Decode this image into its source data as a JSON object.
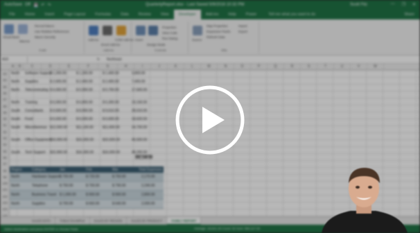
{
  "title_bar": {
    "quick_access": [
      "AutoSave",
      "Off",
      "💾",
      "↶",
      "↷"
    ],
    "document_title": "QuarterlyReport.xlsx - Last Saved 5/9/2016 10:32 PM",
    "user": "Scott Fitz",
    "window_controls": [
      "—",
      "❐",
      "✕"
    ]
  },
  "tabs": {
    "items": [
      "File",
      "Home",
      "Insert",
      "Page Layout",
      "Formulas",
      "Data",
      "Review",
      "View",
      "Developer",
      "Add-ins",
      "Help",
      "Power"
    ],
    "active": "Developer",
    "tell_me": "Tell me what you want to do",
    "share": "Share"
  },
  "ribbon": {
    "groups": [
      {
        "label": "Code",
        "buttons": [
          "Visual Basic",
          "Macros"
        ],
        "items": [
          "Record Macro",
          "Use Relative References",
          "Macro Security"
        ]
      },
      {
        "label": "Add-ins",
        "buttons": [
          "Add-ins",
          "Excel Add-ins",
          "COM Add-ins"
        ]
      },
      {
        "label": "Controls",
        "buttons": [
          "Insert",
          "Design Mode"
        ],
        "items": [
          "Properties",
          "View Code",
          "Run Dialog"
        ]
      },
      {
        "label": "XML",
        "buttons": [
          "Source"
        ],
        "items": [
          "Map Properties",
          "Expansion Packs",
          "Refresh Data",
          "Import",
          "Export"
        ]
      }
    ]
  },
  "formula_bar": {
    "name_box": "A10",
    "fx": "fx",
    "value": "Northeast"
  },
  "columns": [
    "A",
    "B",
    "C",
    "D",
    "E",
    "F",
    "G",
    "H",
    "I",
    "J",
    "K",
    "L",
    "M",
    "N",
    "O",
    "P",
    "Q",
    "R",
    "S",
    "T",
    "U",
    "V",
    "W"
  ],
  "rows": [
    "83",
    "84",
    "85",
    "86",
    "87",
    "88",
    "89",
    "90",
    "91",
    "92",
    "93",
    "94",
    "95",
    "96",
    "97",
    "98",
    "99",
    "100",
    "101",
    "102",
    "103",
    "104",
    "105"
  ],
  "data_rows": [
    {
      "region": "North",
      "category": "Software Support",
      "q1": "$ 1,200.00",
      "q2": "$ 1,200.00",
      "q3": "$ 1,400.00",
      "total": "3,800.00"
    },
    {
      "region": "North",
      "category": "Supplies",
      "q1": "$ 2,600.00",
      "q2": "$ 2,400.00",
      "q3": "$ 2,400.00",
      "total": "7,400.00"
    },
    {
      "region": "North",
      "category": "Telecommuting",
      "q1": "$ 6,000.00",
      "q2": "$ 5,900.00",
      "q3": "$ 5,700.00",
      "total": "17,600.00"
    },
    {
      "region": "North",
      "category": "Training",
      "q1": "$ 6,000.00",
      "q2": "$ 6,800.00",
      "q3": "$ 6,300.00",
      "total": "19,100.00"
    },
    {
      "region": "South",
      "category": "Consultants",
      "q1": "$ 9,500.00",
      "q2": "$ 8,900.00",
      "q3": "$ 9,610.00",
      "total": "28,010.00"
    },
    {
      "region": "South",
      "category": "Food",
      "q1": "$ 6,020.00",
      "q2": "$ 6,000.00",
      "q3": "$ 6,600.00",
      "total": "18,620.00"
    },
    {
      "region": "South",
      "category": "Miscellaneous",
      "q1": "$12,000.00",
      "q2": "$11,100.00",
      "q3": "$11,600.00",
      "total": "34,700.00"
    },
    {
      "region": "South",
      "category": "Office Equipment",
      "q1": "$16,000.00",
      "q2": "$15,000.00",
      "q3": "$15,500.00",
      "total": "46,500.00"
    },
    {
      "region": "South",
      "category": "Tech Support",
      "q1": "$15,900.00",
      "q2": "$16,300.00",
      "q3": "$16,000.00",
      "total": "48,200.00"
    }
  ],
  "grand_total": "291,140.00",
  "table2": {
    "headers": [
      "Region",
      "Category",
      "Jan",
      "Feb",
      "Mar",
      "Total Expenses"
    ],
    "rows": [
      [
        "North",
        "Hardware Support",
        "$ 700.00",
        "$ 720.00",
        "$ 750.00",
        "2,170.00"
      ],
      [
        "North",
        "Telephone",
        "$ 750.00",
        "$ 700.00",
        "$ 790.00",
        "2,240.00"
      ],
      [
        "North",
        "Business Travel",
        "$ 1,000.00",
        "$ 900.00",
        "$ 900.00",
        "2,800.00"
      ],
      [
        "North",
        "Supplies",
        "$ 700.00",
        "$ 660.00",
        "$ 640.00",
        "2,000.00"
      ]
    ]
  },
  "sheet_tabs": [
    "SALES DATA",
    "TABLE EXAMPLE",
    "SALES BY REGION",
    "SALES BY PRODUCT",
    "FAMILY REPORT"
  ],
  "active_sheet": "FAMILY REPORT",
  "status": {
    "message": "Select destination and press ENTER or choose Paste",
    "calc": "Average: 18,921.25   Count: 52   Sum: 584,117.33",
    "zoom": "100%"
  },
  "video": {
    "play_icon": "play-icon",
    "colors": {
      "accent": "#217346",
      "play": "#ffffff"
    }
  }
}
